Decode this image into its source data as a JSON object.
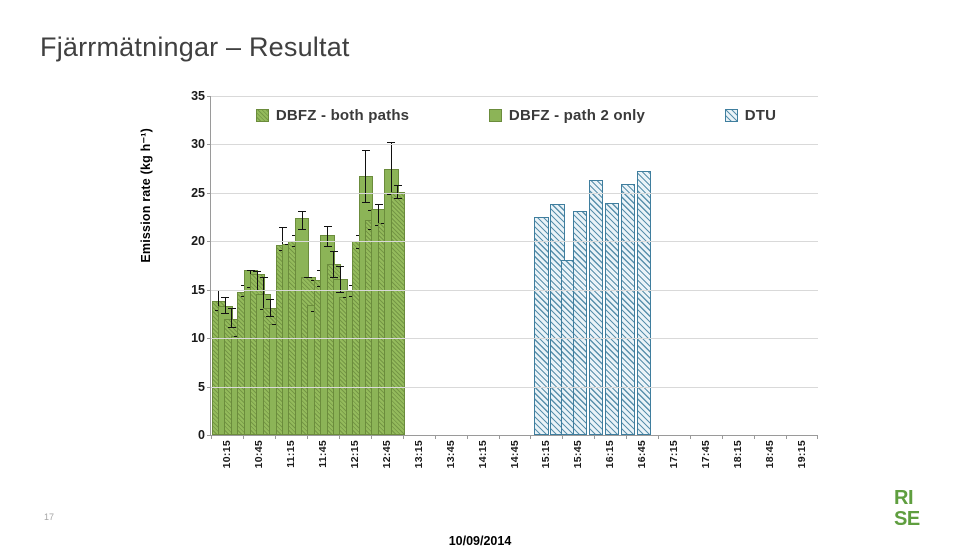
{
  "slide": {
    "title": "Fjärrmätningar – Resultat",
    "number": "17",
    "logo": {
      "line1": "RI",
      "line2": "SE"
    }
  },
  "chart_data": {
    "type": "bar",
    "title": "",
    "xlabel": "10/09/2014",
    "ylabel": "Emission rate (kg h⁻¹)",
    "ylim": [
      0,
      35
    ],
    "yticks": [
      0,
      5,
      10,
      15,
      20,
      25,
      30,
      35
    ],
    "grid": true,
    "legend_position": "top",
    "legend": [
      "DBFZ - both paths",
      "DBFZ - path 2 only",
      "DTU"
    ],
    "colors": {
      "dbfz_both": "#94bb5c",
      "dbfz_path2": "#8cb457",
      "dtu": "#3f7e9e",
      "dtu_fill": "#eaf3f8",
      "grid": "#d9d9d9",
      "axis": "#9a9a9a"
    },
    "categories": [
      "10:15",
      "10:45",
      "11:15",
      "11:45",
      "12:15",
      "12:45",
      "13:15",
      "13:45",
      "14:15",
      "14:45",
      "15:15",
      "15:45",
      "16:15",
      "16:45",
      "17:15",
      "17:45",
      "18:15",
      "18:45",
      "19:15"
    ],
    "bars": [
      {
        "slot": 0.0,
        "series": "dbfz_both",
        "value": 13.8,
        "err_low": 12.8,
        "err_high": 15.0
      },
      {
        "slot": 0.4,
        "series": "dbfz_path2",
        "value": 13.3,
        "err_low": 12.5,
        "err_high": 14.2
      },
      {
        "slot": 0.8,
        "series": "dbfz_both",
        "value": 12.0,
        "err_low": 11.0,
        "err_high": 13.1
      },
      {
        "slot": 1.2,
        "series": "dbfz_path2",
        "value": 10.2,
        "err_low": 10.2,
        "err_high": 10.2
      },
      {
        "slot": 1.6,
        "series": "dbfz_both",
        "value": 14.8,
        "err_low": 14.2,
        "err_high": 15.5
      },
      {
        "slot": 2.0,
        "series": "dbfz_path2",
        "value": 17.0,
        "err_low": 15.2,
        "err_high": 17.0
      },
      {
        "slot": 2.4,
        "series": "dbfz_both",
        "value": 16.6,
        "err_low": 14.9,
        "err_high": 16.9
      },
      {
        "slot": 2.8,
        "series": "dbfz_path2",
        "value": 14.6,
        "err_low": 12.9,
        "err_high": 16.3
      },
      {
        "slot": 3.2,
        "series": "dbfz_both",
        "value": 13.1,
        "err_low": 12.2,
        "err_high": 14.0
      },
      {
        "slot": 3.6,
        "series": "dbfz_path2",
        "value": 11.5,
        "err_low": 11.5,
        "err_high": 11.5
      },
      {
        "slot": 4.0,
        "series": "dbfz_both",
        "value": 19.6,
        "err_low": 19.0,
        "err_high": 21.5
      },
      {
        "slot": 4.4,
        "series": "dbfz_path2",
        "value": 19.7,
        "err_low": 19.7,
        "err_high": 19.7
      },
      {
        "slot": 4.8,
        "series": "dbfz_both",
        "value": 20.0,
        "err_low": 19.4,
        "err_high": 20.6
      },
      {
        "slot": 5.2,
        "series": "dbfz_path2",
        "value": 22.4,
        "err_low": 21.2,
        "err_high": 23.1
      },
      {
        "slot": 5.6,
        "series": "dbfz_both",
        "value": 16.3,
        "err_low": 16.3,
        "err_high": 16.3
      },
      {
        "slot": 6.0,
        "series": "dbfz_path2",
        "value": 13.4,
        "err_low": 12.7,
        "err_high": 16.0
      },
      {
        "slot": 6.4,
        "series": "dbfz_both",
        "value": 16.0,
        "err_low": 15.3,
        "err_high": 17.0
      },
      {
        "slot": 6.8,
        "series": "dbfz_path2",
        "value": 20.7,
        "err_low": 19.4,
        "err_high": 21.6
      },
      {
        "slot": 7.2,
        "series": "dbfz_both",
        "value": 17.7,
        "err_low": 16.2,
        "err_high": 19.0
      },
      {
        "slot": 7.6,
        "series": "dbfz_path2",
        "value": 16.1,
        "err_low": 14.7,
        "err_high": 17.4
      },
      {
        "slot": 8.0,
        "series": "dbfz_both",
        "value": 14.2,
        "err_low": 14.2,
        "err_high": 14.2
      },
      {
        "slot": 8.4,
        "series": "dbfz_path2",
        "value": 14.9,
        "err_low": 14.2,
        "err_high": 15.5
      },
      {
        "slot": 8.8,
        "series": "dbfz_both",
        "value": 20.0,
        "err_low": 19.2,
        "err_high": 20.6
      },
      {
        "slot": 9.2,
        "series": "dbfz_path2",
        "value": 26.7,
        "err_low": 24.0,
        "err_high": 29.4
      },
      {
        "slot": 9.6,
        "series": "dbfz_both",
        "value": 22.2,
        "err_low": 21.2,
        "err_high": 23.2
      },
      {
        "slot": 10.0,
        "series": "dbfz_path2",
        "value": 23.3,
        "err_low": 21.6,
        "err_high": 23.9
      },
      {
        "slot": 10.4,
        "series": "dbfz_both",
        "value": 21.9,
        "err_low": 21.9,
        "err_high": 21.9
      },
      {
        "slot": 10.8,
        "series": "dbfz_path2",
        "value": 27.5,
        "err_low": 24.8,
        "err_high": 30.3
      },
      {
        "slot": 11.2,
        "series": "dbfz_both",
        "value": 25.1,
        "err_low": 24.4,
        "err_high": 25.8
      },
      {
        "slot": 20.2,
        "series": "dtu",
        "value": 22.5
      },
      {
        "slot": 21.2,
        "series": "dtu",
        "value": 23.8
      },
      {
        "slot": 21.9,
        "series": "dtu",
        "value": 18.1
      },
      {
        "slot": 22.6,
        "series": "dtu",
        "value": 23.1
      },
      {
        "slot": 23.6,
        "series": "dtu",
        "value": 26.3
      },
      {
        "slot": 24.6,
        "series": "dtu",
        "value": 24.0
      },
      {
        "slot": 25.6,
        "series": "dtu",
        "value": 25.9
      },
      {
        "slot": 26.6,
        "series": "dtu",
        "value": 27.3
      }
    ]
  }
}
